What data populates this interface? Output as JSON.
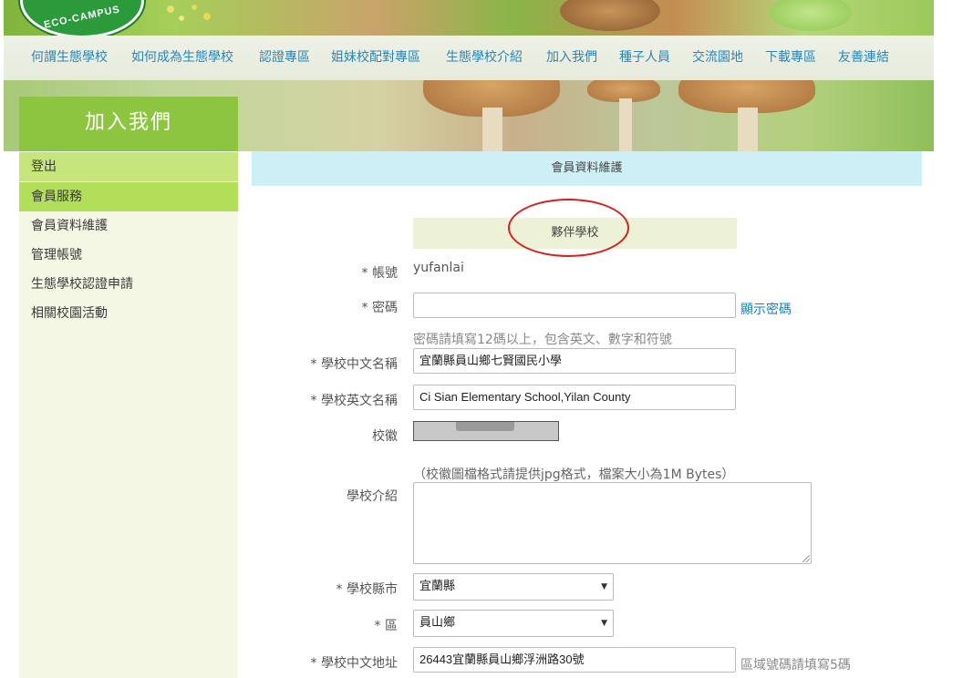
{
  "logo": {
    "text": "ECO-CAMPUS"
  },
  "nav": {
    "items": [
      "何謂生態學校",
      "如何成為生態學校",
      "認證專區",
      "姐妹校配對專區",
      "生態學校介紹",
      "加入我們",
      "種子人員",
      "交流園地",
      "下載專區",
      "友善連結"
    ]
  },
  "sidebar": {
    "title": "加入我們",
    "items": [
      "登出",
      "會員服務",
      "會員資料維護",
      "管理帳號",
      "生態學校認證申請",
      "相關校園活動"
    ]
  },
  "main": {
    "section_title": "會員資料維護",
    "member_type": "夥伴學校",
    "fields": {
      "account_label": "* 帳號",
      "account_value": "yufanlai",
      "password_label": "* 密碼",
      "password_value": "",
      "show_password": "顯示密碼",
      "password_hint": "密碼請填寫12碼以上，包含英文、數字和符號",
      "name_zh_label": "* 學校中文名稱",
      "name_zh_value": "宜蘭縣員山鄉七賢國民小學",
      "name_en_label": "* 學校英文名稱",
      "name_en_value": "Ci Sian Elementary School,Yilan County",
      "badge_label": "校徽",
      "badge_hint": "（校徽圖檔格式請提供jpg格式，檔案大小為1M Bytes）",
      "intro_label": "學校介紹",
      "intro_value": "",
      "county_label": "* 學校縣市",
      "county_value": "宜蘭縣",
      "district_label": "* 區",
      "district_value": "員山鄉",
      "address_label": "* 學校中文地址",
      "address_value": "26443宜蘭縣員山鄉浮洲路30號",
      "address_hint": "區域號碼請填寫5碼"
    }
  },
  "colors": {
    "sidebar_head": "#8cc63f",
    "nav_link": "#2b86b8",
    "section_bar": "#cdf0f7",
    "highlight_ellipse": "#d42020"
  }
}
